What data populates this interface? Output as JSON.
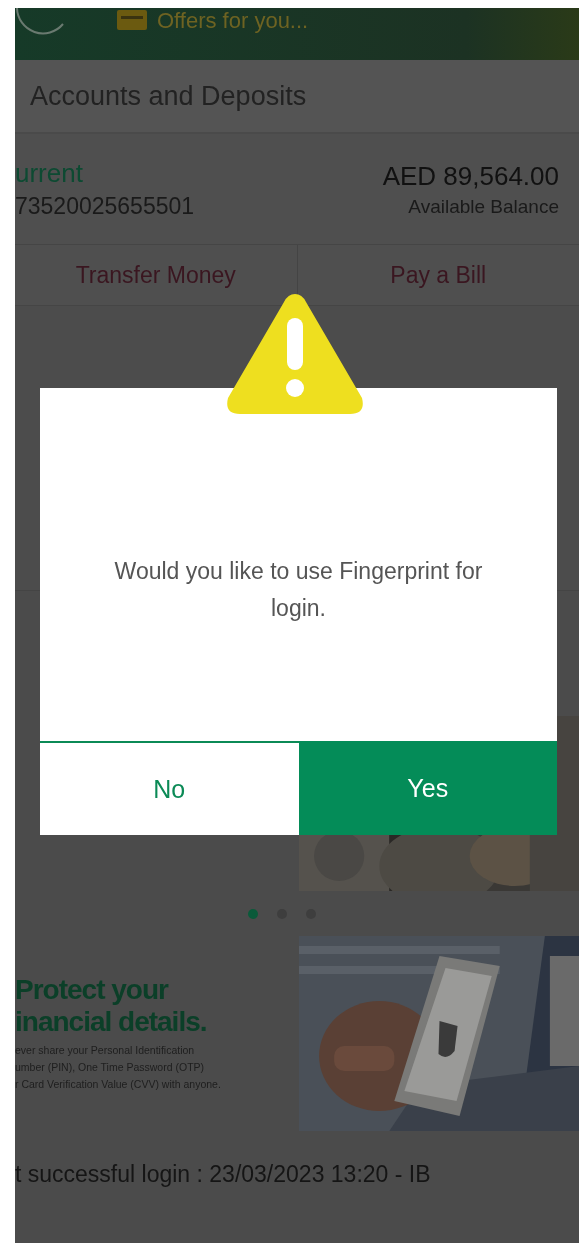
{
  "header": {
    "offers_label": "Offers for you..."
  },
  "accounts": {
    "title": "Accounts and Deposits",
    "account": {
      "type": "urrent",
      "number": "73520025655501",
      "balance": "AED 89,564.00",
      "balance_label": "Available Balance"
    },
    "actions": [
      "Transfer Money",
      "Pay a Bill"
    ]
  },
  "carousel": {
    "dots": [
      {
        "selected": true
      },
      {
        "selected": false
      },
      {
        "selected": false
      }
    ]
  },
  "banner": {
    "title_lines": [
      "Protect your",
      "inancial details."
    ],
    "text_lines": [
      "ever share your Personal Identification",
      "umber (PIN), One Time Password (OTP)",
      "r Card Verification Value (CVV) with anyone."
    ]
  },
  "last_login": "t successful login : 23/03/2023 13:20 - IB",
  "dialog": {
    "message": "Would you like to use Fingerprint for login.",
    "buttons": [
      {
        "label": "No",
        "kind": "secondary"
      },
      {
        "label": "Yes",
        "kind": "primary"
      }
    ]
  }
}
